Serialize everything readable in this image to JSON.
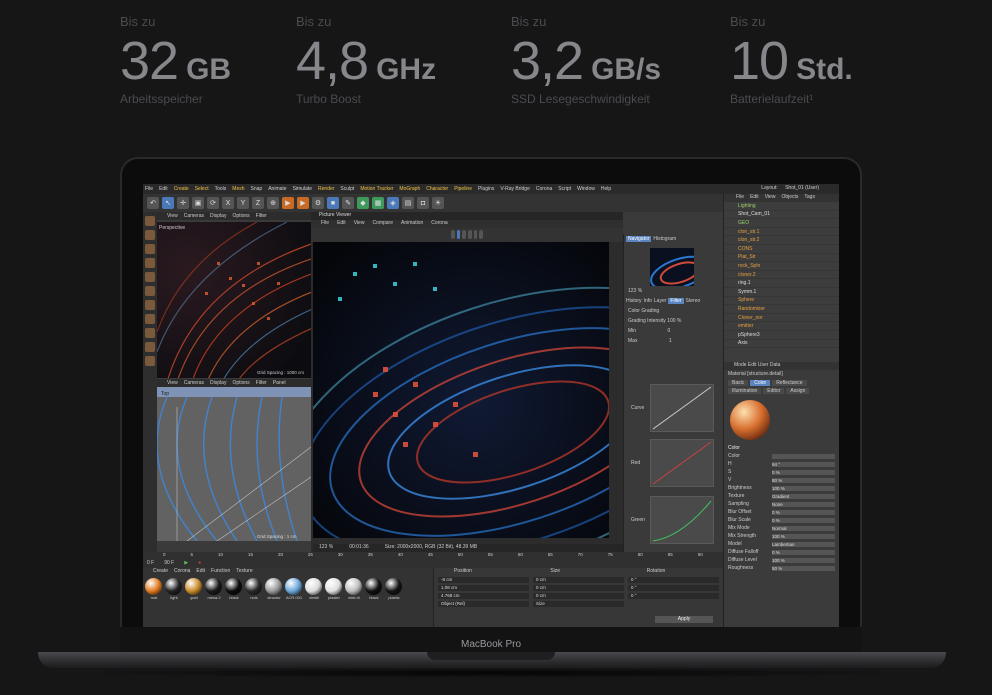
{
  "specs": [
    {
      "pre": "Bis zu",
      "num": "32",
      "unit": "GB",
      "label": "Arbeitsspeicher"
    },
    {
      "pre": "Bis zu",
      "num": "4,8",
      "unit": "GHz",
      "label": "Turbo Boost"
    },
    {
      "pre": "Bis zu",
      "num": "3,2",
      "unit": "GB/s",
      "label": "SSD Lesegeschwindigkeit"
    },
    {
      "pre": "Bis zu",
      "num": "10",
      "unit": "Std.",
      "label": "Batterielaufzeit¹"
    }
  ],
  "laptop": {
    "brand": "MacBook Pro"
  },
  "app": {
    "menu": [
      "File",
      "Edit",
      "Create",
      "Select",
      "Tools",
      "Mesh",
      "Snap",
      "Animate",
      "Simulate",
      "Render",
      "Sculpt",
      "Motion Tracker",
      "MoGraph",
      "Character",
      "Pipeline",
      "Plugins",
      "V-Ray Bridge",
      "Corona",
      "Script",
      "Window",
      "Help"
    ],
    "layout_label": "Layout:",
    "layout_value": "Shot_01 (User)",
    "toolbar_letters": [
      "X",
      "Y",
      "Z"
    ],
    "viewport_menu": [
      "View",
      "Cameras",
      "Display",
      "Options",
      "Filter",
      "Panel"
    ],
    "viewport1_name": "Perspective",
    "viewport1_grid": "Grid Spacing : 1000 cm",
    "viewport2_name": "Top",
    "viewport2_grid": "Grid Spacing : 1 cm",
    "picture_viewer": {
      "title": "Picture Viewer",
      "menu": [
        "File",
        "Edit",
        "View",
        "Compare",
        "Animation",
        "Corona"
      ],
      "zoom": "123 %",
      "time": "00:01:36",
      "size": "Size: 2000x2000, RGB (32 Bit), 48.39 MB"
    },
    "navigator": {
      "tabs": [
        "Navigator",
        "Histogram"
      ],
      "zoom": "123 %",
      "subtabs": [
        "History",
        "Info",
        "Layer",
        "Filter",
        "Stereo"
      ],
      "section": "Color Grading",
      "intensity_label": "Grading Intensity",
      "intensity_value": "100 %",
      "min_label": "Min",
      "min_value": "0",
      "max_label": "Max",
      "max_value": "1",
      "curves": [
        "Curve",
        "Red",
        "Green"
      ]
    },
    "objects": {
      "header": [
        "File",
        "Edit",
        "View",
        "Objects",
        "Tags"
      ],
      "items": [
        {
          "name": "Lighting",
          "kind": "grp"
        },
        {
          "name": "Shot_Cam_01",
          "kind": ""
        },
        {
          "name": "GEO",
          "kind": "grp"
        },
        {
          "name": "clon_str.1",
          "kind": "sel"
        },
        {
          "name": "clon_str.2",
          "kind": "sel"
        },
        {
          "name": "CONS",
          "kind": "sel"
        },
        {
          "name": "Plat_Str",
          "kind": "sel"
        },
        {
          "name": "rock_Spln",
          "kind": "sel"
        },
        {
          "name": "cloner.2",
          "kind": "sel"
        },
        {
          "name": "ring.1",
          "kind": ""
        },
        {
          "name": "Symm.1",
          "kind": ""
        },
        {
          "name": "Sphere",
          "kind": "sel"
        },
        {
          "name": "Randomizer",
          "kind": "sel"
        },
        {
          "name": "Cloner_nor",
          "kind": "sel"
        },
        {
          "name": "emitter",
          "kind": "sel"
        },
        {
          "name": "pSphere3",
          "kind": ""
        },
        {
          "name": "Axis",
          "kind": ""
        }
      ]
    },
    "attributes": {
      "header": "Mode   Edit   User Data",
      "material": "Material [structure.detail]",
      "tabs": [
        "Basic",
        "Color",
        "Reflectance",
        "Illumination",
        "Editor",
        "Assign"
      ],
      "active_tab": "Color",
      "section": "Color",
      "rows": [
        {
          "label": "Color",
          "value": ""
        },
        {
          "label": "H",
          "value": "94 °"
        },
        {
          "label": "S",
          "value": "0 %"
        },
        {
          "label": "V",
          "value": "80 %"
        },
        {
          "label": "Brightness",
          "value": "100 %"
        },
        {
          "label": "Texture",
          "value": "Gradient"
        },
        {
          "label": "Sampling",
          "value": "None"
        },
        {
          "label": "Blur Offset",
          "value": "0 %"
        },
        {
          "label": "Blur Scale",
          "value": "0 %"
        },
        {
          "label": "Mix Mode",
          "value": "Normal"
        },
        {
          "label": "Mix Strength",
          "value": "100 %"
        },
        {
          "label": "Model",
          "value": "Lambertian"
        },
        {
          "label": "Diffuse Falloff",
          "value": "0 %"
        },
        {
          "label": "Diffuse Level",
          "value": "100 %"
        },
        {
          "label": "Roughness",
          "value": "50 %"
        }
      ]
    },
    "timeline": {
      "frame": "0 F",
      "end": "90 F",
      "ticks": [
        "0",
        "5",
        "10",
        "15",
        "20",
        "25",
        "30",
        "35",
        "40",
        "45",
        "50",
        "55",
        "60",
        "65",
        "70",
        "75",
        "80",
        "85",
        "90"
      ],
      "current": "0 F"
    },
    "material_manager": {
      "menu": [
        "Create",
        "Corona",
        "Edit",
        "Function",
        "Texture"
      ],
      "materials": [
        {
          "name": "mat",
          "color": "#e07a20"
        },
        {
          "name": "light",
          "color": "#222222"
        },
        {
          "name": "gold",
          "color": "#c98a2a"
        },
        {
          "name": "mesa.2",
          "color": "#1a1a1a"
        },
        {
          "name": "black",
          "color": "#0d0d0d"
        },
        {
          "name": "nois",
          "color": "#2a2a2a"
        },
        {
          "name": "structur",
          "color": "#9a9a9a"
        },
        {
          "name": "ACR.001",
          "color": "#6aa6d8"
        },
        {
          "name": "detail",
          "color": "#dcdcdc"
        },
        {
          "name": "plaster",
          "color": "#e0e0e0"
        },
        {
          "name": "elek.hi",
          "color": "#bdbdbd"
        },
        {
          "name": "black",
          "color": "#111111"
        },
        {
          "name": "plastic",
          "color": "#151515"
        }
      ]
    },
    "coordinates": {
      "headers": [
        "Position",
        "Size",
        "Rotation"
      ],
      "rows": [
        [
          "-8 cm",
          "X",
          "0 cm",
          "H",
          "0 °"
        ],
        [
          "1.08 cm",
          "Y",
          "0 cm",
          "P",
          "0 °"
        ],
        [
          "4.768 cm",
          "Z",
          "0 cm",
          "B",
          "0 °"
        ]
      ],
      "mode_object": "Object (Rel)",
      "mode_size": "Size",
      "apply": "Apply"
    }
  }
}
